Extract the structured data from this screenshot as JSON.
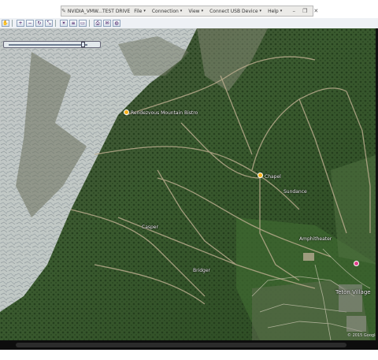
{
  "window": {
    "title": "NVIDIA_VMW...TEST DRIVE",
    "menus": [
      {
        "label": "File"
      },
      {
        "label": "Connection"
      },
      {
        "label": "View"
      },
      {
        "label": "Connect USB Device"
      },
      {
        "label": "Help"
      }
    ]
  },
  "toolbar": {
    "icons": [
      "hand-icon",
      "zoom-in-icon",
      "zoom-out-icon",
      "rotate-icon",
      "tilt-icon",
      "sun-icon",
      "layers-icon",
      "ruler-icon",
      "print-icon",
      "email-icon",
      "globe-icon"
    ]
  },
  "map": {
    "labels": [
      {
        "text": "Rendezvous Mountain Bistro"
      },
      {
        "text": "Chapel"
      },
      {
        "text": "Teton Village"
      },
      {
        "text": "Casper"
      },
      {
        "text": "Bridger"
      },
      {
        "text": "Sundance"
      },
      {
        "text": "Amphitheater"
      }
    ],
    "copyright": "© 2015 Google"
  },
  "colors": {
    "menubar_bg": "#ecebe8",
    "toolbar_bg": "#eef1f5",
    "forest": "#2d4a26",
    "snow": "#e6e9ec"
  }
}
